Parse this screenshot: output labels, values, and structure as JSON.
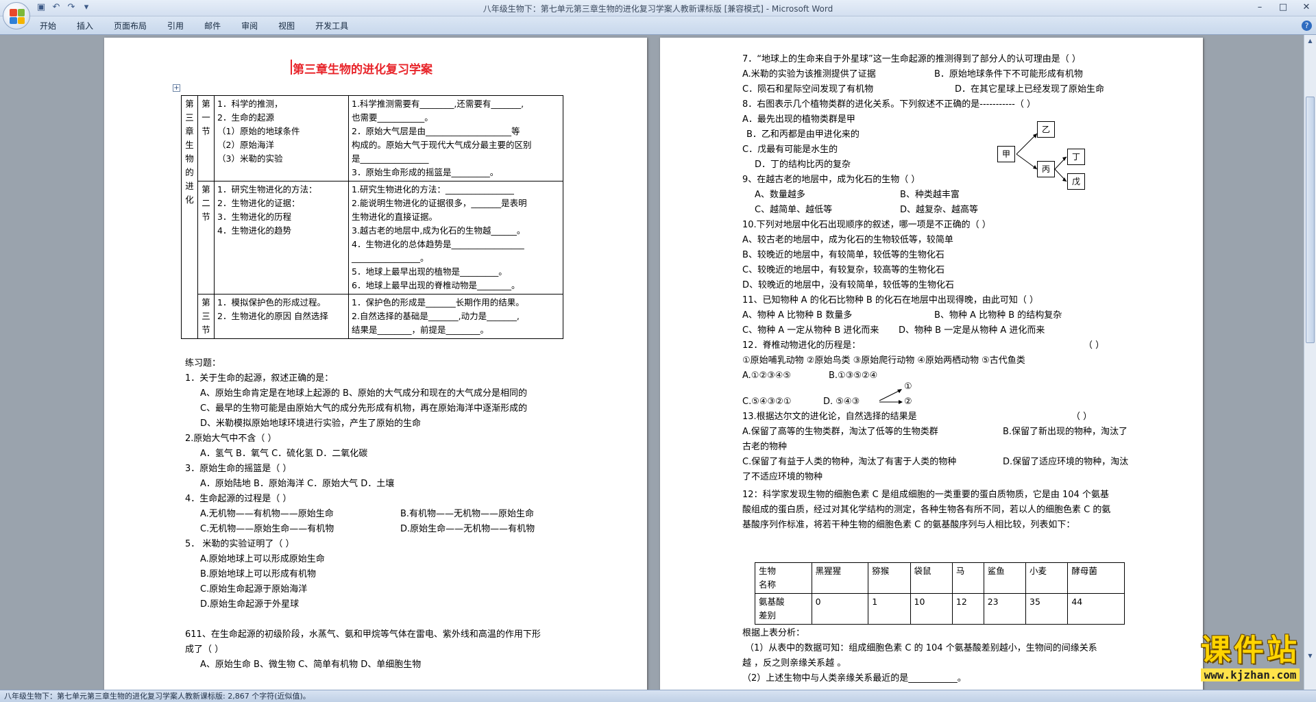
{
  "window": {
    "title": "八年级生物下：第七单元第三章生物的进化复习学案人教新课标版 [兼容模式] - Microsoft Word",
    "controls": [
      "–",
      "□",
      "✕"
    ]
  },
  "quick_access": [
    "save-icon",
    "undo-icon",
    "redo-icon",
    "customize-icon"
  ],
  "ribbon": {
    "tabs": [
      "开始",
      "插入",
      "页面布局",
      "引用",
      "邮件",
      "审阅",
      "视图",
      "开发工具"
    ],
    "help": "?"
  },
  "page1": {
    "title": "第三章生物的进化复习学案",
    "table": {
      "chapter": [
        "第",
        "三",
        "章",
        "生",
        "物",
        "的",
        "进",
        "化"
      ],
      "sections": [
        {
          "name": [
            "第",
            "一",
            "节"
          ],
          "left": [
            "1．科学的推测，",
            "2．生命的起源",
            "（1）原始的地球条件",
            "（2）原始海洋",
            "（3）米勒的实验"
          ],
          "right": [
            "1.科学推测需要有________,还需要有_______,",
            "也需要___________。",
            "2．原始大气层是由____________________等",
            "构成的。原始大气于现代大气成分最主要的区别",
            "是________________",
            "3．原始生命形成的摇篮是_________。"
          ]
        },
        {
          "name": [
            "第",
            "二",
            "节"
          ],
          "left": [
            "1．研究生物进化的方法：",
            "2．生物进化的证据：",
            "3．生物进化的历程",
            "4．生物进化的趋势"
          ],
          "right": [
            "1.研究生物进化的方法：________________",
            "2.能说明生物进化的证据很多，_______是表明",
            "生物进化的直接证据。",
            "3.越古老的地层中,成为化石的生物越______。",
            "4．生物进化的总体趋势是_________________",
            "________________。",
            "5．地球上最早出现的植物是_________。",
            "6．地球上最早出现的脊椎动物是________。"
          ]
        },
        {
          "name": [
            "第",
            "三",
            "节"
          ],
          "left": [
            "1．模拟保护色的形成过程。",
            "2．生物进化的原因 自然选择"
          ],
          "right": [
            "1．保护色的形成是_______长期作用的结果。",
            "2.自然选择的基础是_______,动力是_______,",
            "结果是________，前提是________。"
          ]
        }
      ]
    },
    "exercises": [
      "练习题：",
      "1．关于生命的起源，叙述正确的是：",
      "A、原始生命肯定是在地球上起源的 B、原始的大气成分和现在的大气成分是相同的",
      "C、最早的生物可能是由原始大气的成分先形成有机物，再在原始海洋中逐渐形成的",
      "D、米勒模拟原始地球环境进行实验，产生了原始的生命",
      "2.原始大气中不含（    ）",
      "A．氢气     B．氧气     C．硫化氢     D．二氧化碳",
      "3．原始生命的摇篮是（                    ）",
      "A．原始陆地             B．原始海洋                 C．原始大气             D．土壤",
      "4．生命起源的过程是（        ）",
      "A.无机物——有机物——原始生命",
      "B.有机物——无机物——原始生命",
      "C.无机物——原始生命——有机物",
      "D.原始生命——无机物——有机物",
      "5．   米勒的实验证明了（  ）",
      "A.原始地球上可以形成原始生命",
      "B.原始地球上可以形成有机物",
      "C.原始生命起源于原始海洋",
      "D.原始生命起源于外星球",
      "611、在生命起源的初级阶段，水蒸气、氨和甲烷等气体在雷电、紫外线和高温的作用下形",
      "成了（    ）",
      "A、原始生命     B、微生物     C、简单有机物       D、单细胞生物"
    ]
  },
  "page2": {
    "lines": [
      "7．“地球上的生命来自于外星球”这一生命起源的推测得到了部分人的认可理由是（    ）",
      "A.米勒的实验为该推测提供了证据",
      "B．原始地球条件下不可能形成有机物",
      "C．陨石和星际空间发现了有机物",
      "D．在其它星球上已经发现了原始生命",
      "8．右图表示几个植物类群的进化关系。下列叙述不正确的是-----------（          ）",
      "A．最先出现的植物类群是甲",
      "B．乙和丙都是由甲进化来的",
      "C．戊最有可能是水生的",
      "D．丁的结构比丙的复杂",
      "9、在越古老的地层中，成为化石的生物（     ）",
      "A、数量越多",
      "B、种类越丰富",
      "C、越简单、越低等",
      "D、越复杂、越高等",
      "10.下列对地层中化石出现顺序的叙述，哪一项是不正确的（          ）",
      "A、较古老的地层中，成为化石的生物较低等，较简单",
      "B、较晚近的地层中，有较简单，较低等的生物化石",
      "C、较晚近的地层中，有较复杂，较高等的生物化石",
      "D、较晚近的地层中，没有较简单，较低等的生物化石",
      "11、已知物种 A 的化石比物种 B 的化石在地层中出现得晚，由此可知（   ）",
      "A、物种 A 比物种 B 数量多",
      "B、物种 A 比物种 B 的结构复杂",
      "C、物种 A 一定从物种 B 进化而来",
      "D、物种 B 一定是从物种 A 进化而来",
      "12．脊椎动物进化的历程是：",
      "（    ）",
      "①原始哺乳动物 ②原始鸟类 ③原始爬行动物 ④原始两栖动物 ⑤古代鱼类",
      "A.①②③④⑤",
      "B.①③⑤②④",
      "①",
      "C.⑤④③②①",
      "D.   ⑤④③",
      "②",
      "13.根据达尔文的进化论，自然选择的结果是",
      "（      ）",
      "A.保留了高等的生物类群，淘汰了低等的生物类群",
      "B.保留了新出现的物种，淘汰了",
      "古老的物种",
      "C.保留了有益于人类的物种，淘汰了有害于人类的物种",
      "D.保留了适应环境的物种，淘汰",
      "了不适应环境的物种",
      "12：科学家发现生物的细胞色素 C 是组成细胞的一类重要的蛋白质物质，它是由 104 个氨基",
      "酸组成的蛋白质，经过对其化学结构的测定，各种生物各有所不同，若以人的细胞色素 C 的氨",
      "基酸序列作标准，将若干种生物的细胞色素 C 的氨基酸序列与人相比较，列表如下：",
      "根据上表分析：",
      "（1）从表中的数据可知：组成细胞色素 C 的 104 个氨基酸差别越小，生物间的间缘关系",
      "越            ，反之则亲缘关系越           。",
      "（2）上述生物中与人类亲缘关系最近的是___________。"
    ],
    "family": [
      "甲",
      "乙",
      "丙",
      "丁",
      "戊"
    ],
    "data_table": {
      "header_label": [
        "生物",
        "名称"
      ],
      "header": [
        "黑猩猩",
        "猕猴",
        "袋鼠",
        "马",
        "鲨鱼",
        "小麦",
        "酵母菌"
      ],
      "row_label": [
        "氨基酸",
        "差别"
      ],
      "values": [
        "0",
        "1",
        "10",
        "12",
        "23",
        "35",
        "44"
      ]
    }
  },
  "statusbar": "八年级生物下：第七单元第三章生物的进化复习学案人教新课标版: 2,867 个字符(近似值)。",
  "watermark": {
    "text": "课件站",
    "url": "www.kjzhan.com"
  }
}
